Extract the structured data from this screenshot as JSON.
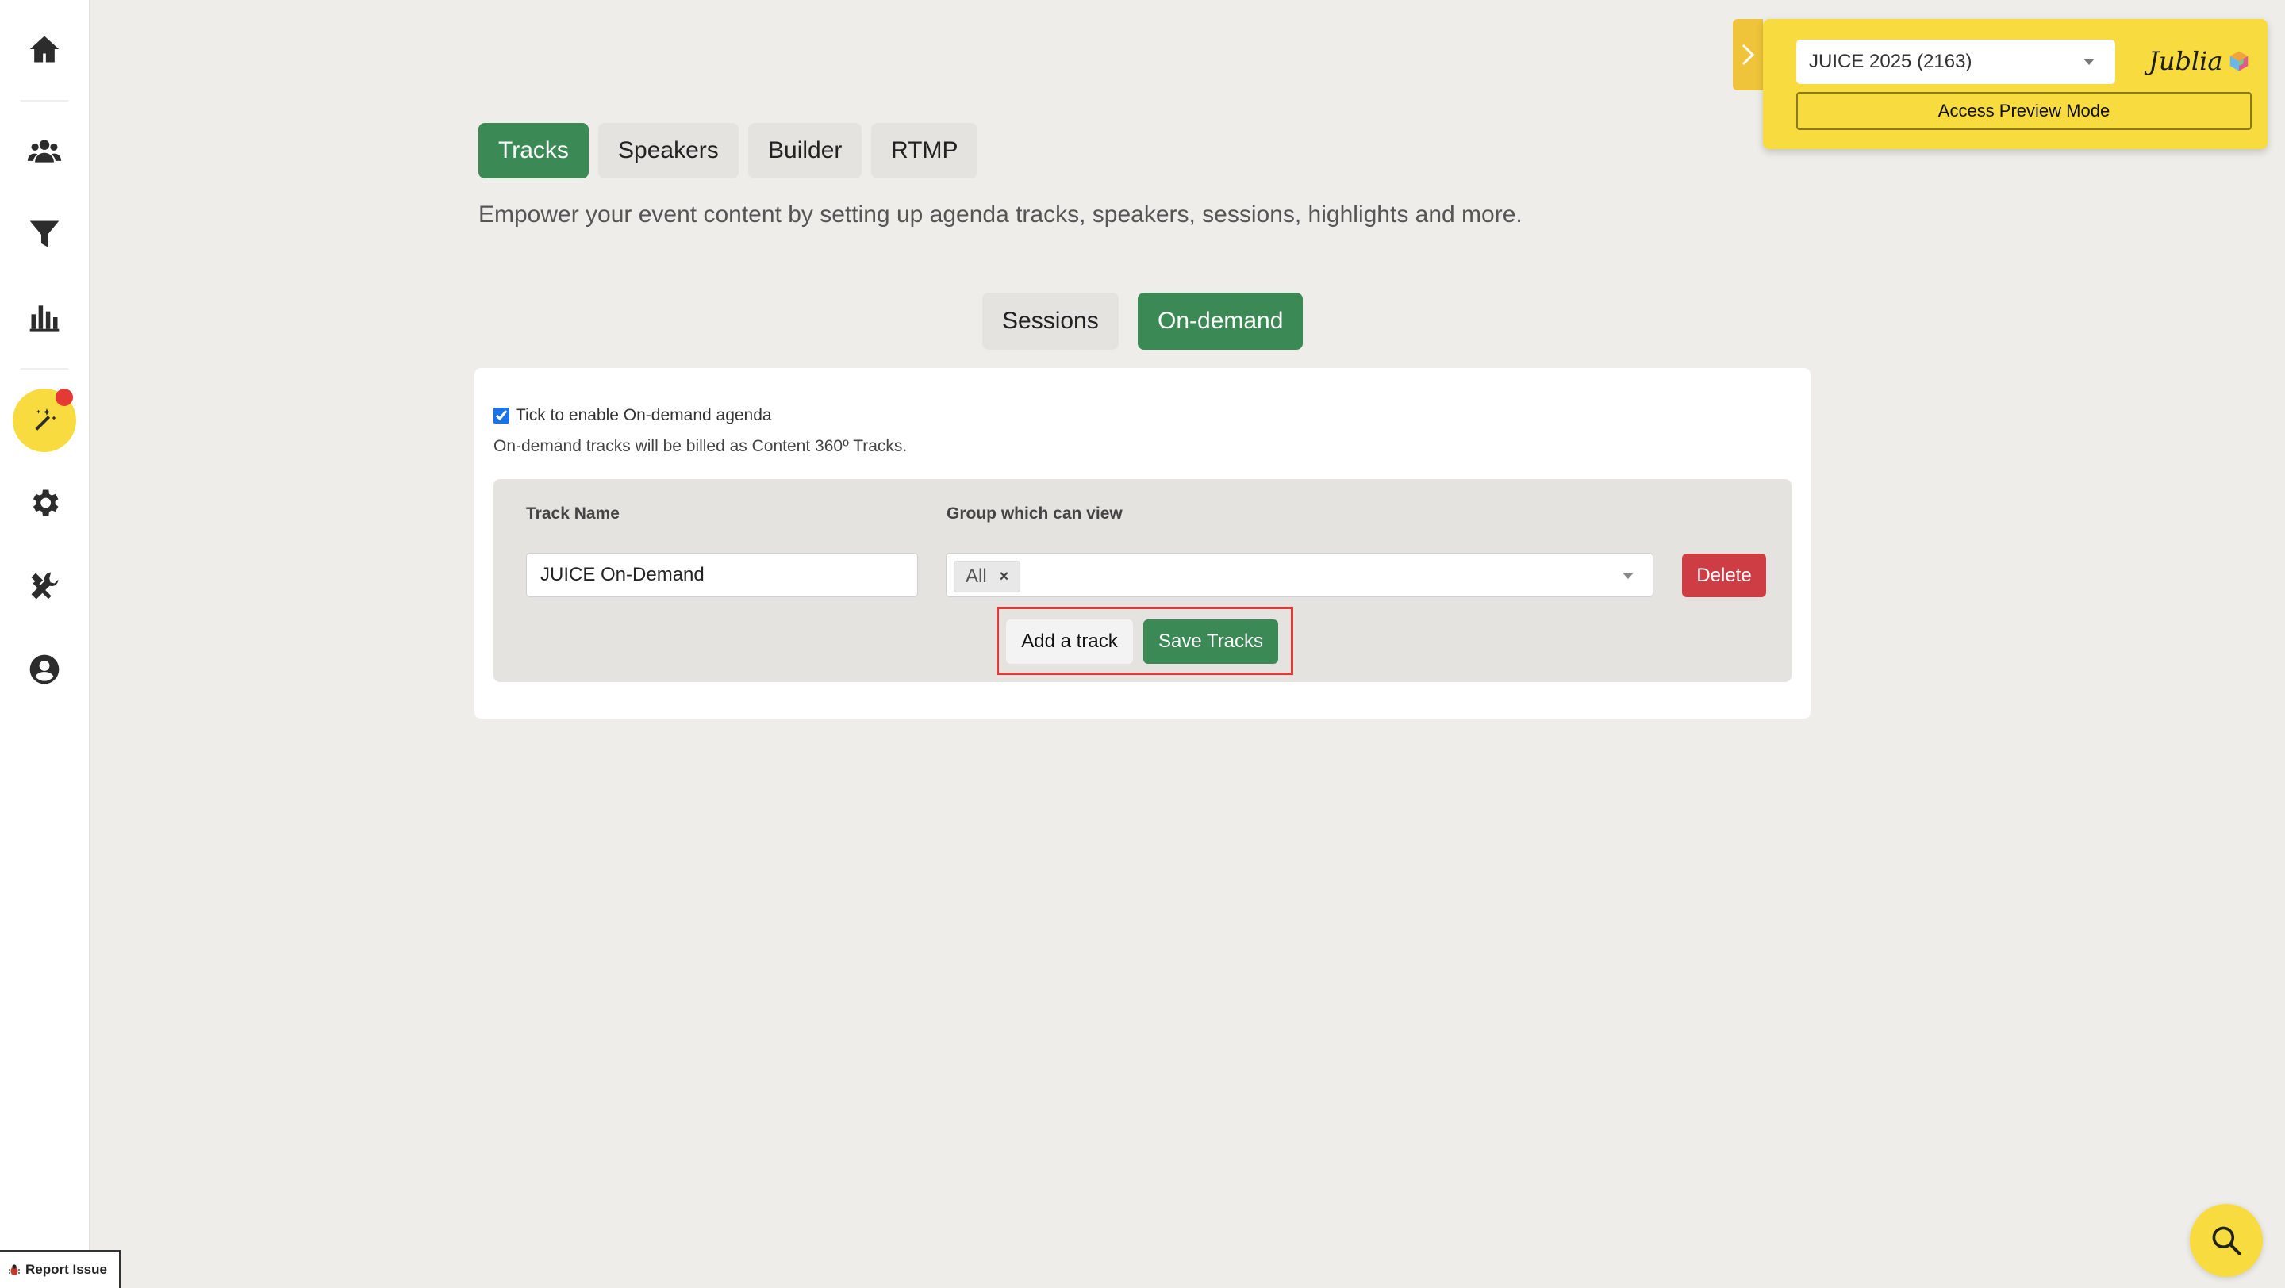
{
  "sidebar": {
    "items": [
      {
        "name": "home",
        "icon": "home-icon"
      },
      {
        "name": "attendees",
        "icon": "users-icon"
      },
      {
        "name": "filter",
        "icon": "filter-icon"
      },
      {
        "name": "analytics",
        "icon": "bar-chart-icon"
      },
      {
        "name": "content",
        "icon": "magic-wand-icon",
        "active": true,
        "has_notification": true
      },
      {
        "name": "settings",
        "icon": "gear-icon"
      },
      {
        "name": "tools",
        "icon": "tools-icon"
      },
      {
        "name": "account",
        "icon": "user-circle-icon"
      }
    ]
  },
  "tabs": [
    {
      "label": "Tracks",
      "active": true
    },
    {
      "label": "Speakers",
      "active": false
    },
    {
      "label": "Builder",
      "active": false
    },
    {
      "label": "RTMP",
      "active": false
    }
  ],
  "description": "Empower your event content by setting up agenda tracks, speakers, sessions, highlights and more.",
  "subtabs": [
    {
      "label": "Sessions",
      "active": false
    },
    {
      "label": "On-demand",
      "active": true
    }
  ],
  "ondemand": {
    "enable_label": "Tick to enable On-demand agenda",
    "enabled": true,
    "billing_note": "On-demand tracks will be billed as Content 360º Tracks.",
    "columns": {
      "track_name": "Track Name",
      "group": "Group which can view"
    },
    "track": {
      "name": "JUICE On-Demand",
      "group_chip": "All",
      "chip_remove": "×"
    },
    "delete_label": "Delete",
    "add_label": "Add a track",
    "save_label": "Save Tracks"
  },
  "event_panel": {
    "selected_event": "JUICE 2025 (2163)",
    "brand": "Jublia",
    "preview_label": "Access Preview Mode"
  },
  "report_issue_label": "Report Issue",
  "colors": {
    "accent_green": "#3b8a55",
    "brand_yellow": "#f8dc3f",
    "danger_red": "#cf3d44",
    "background": "#eeede9"
  }
}
